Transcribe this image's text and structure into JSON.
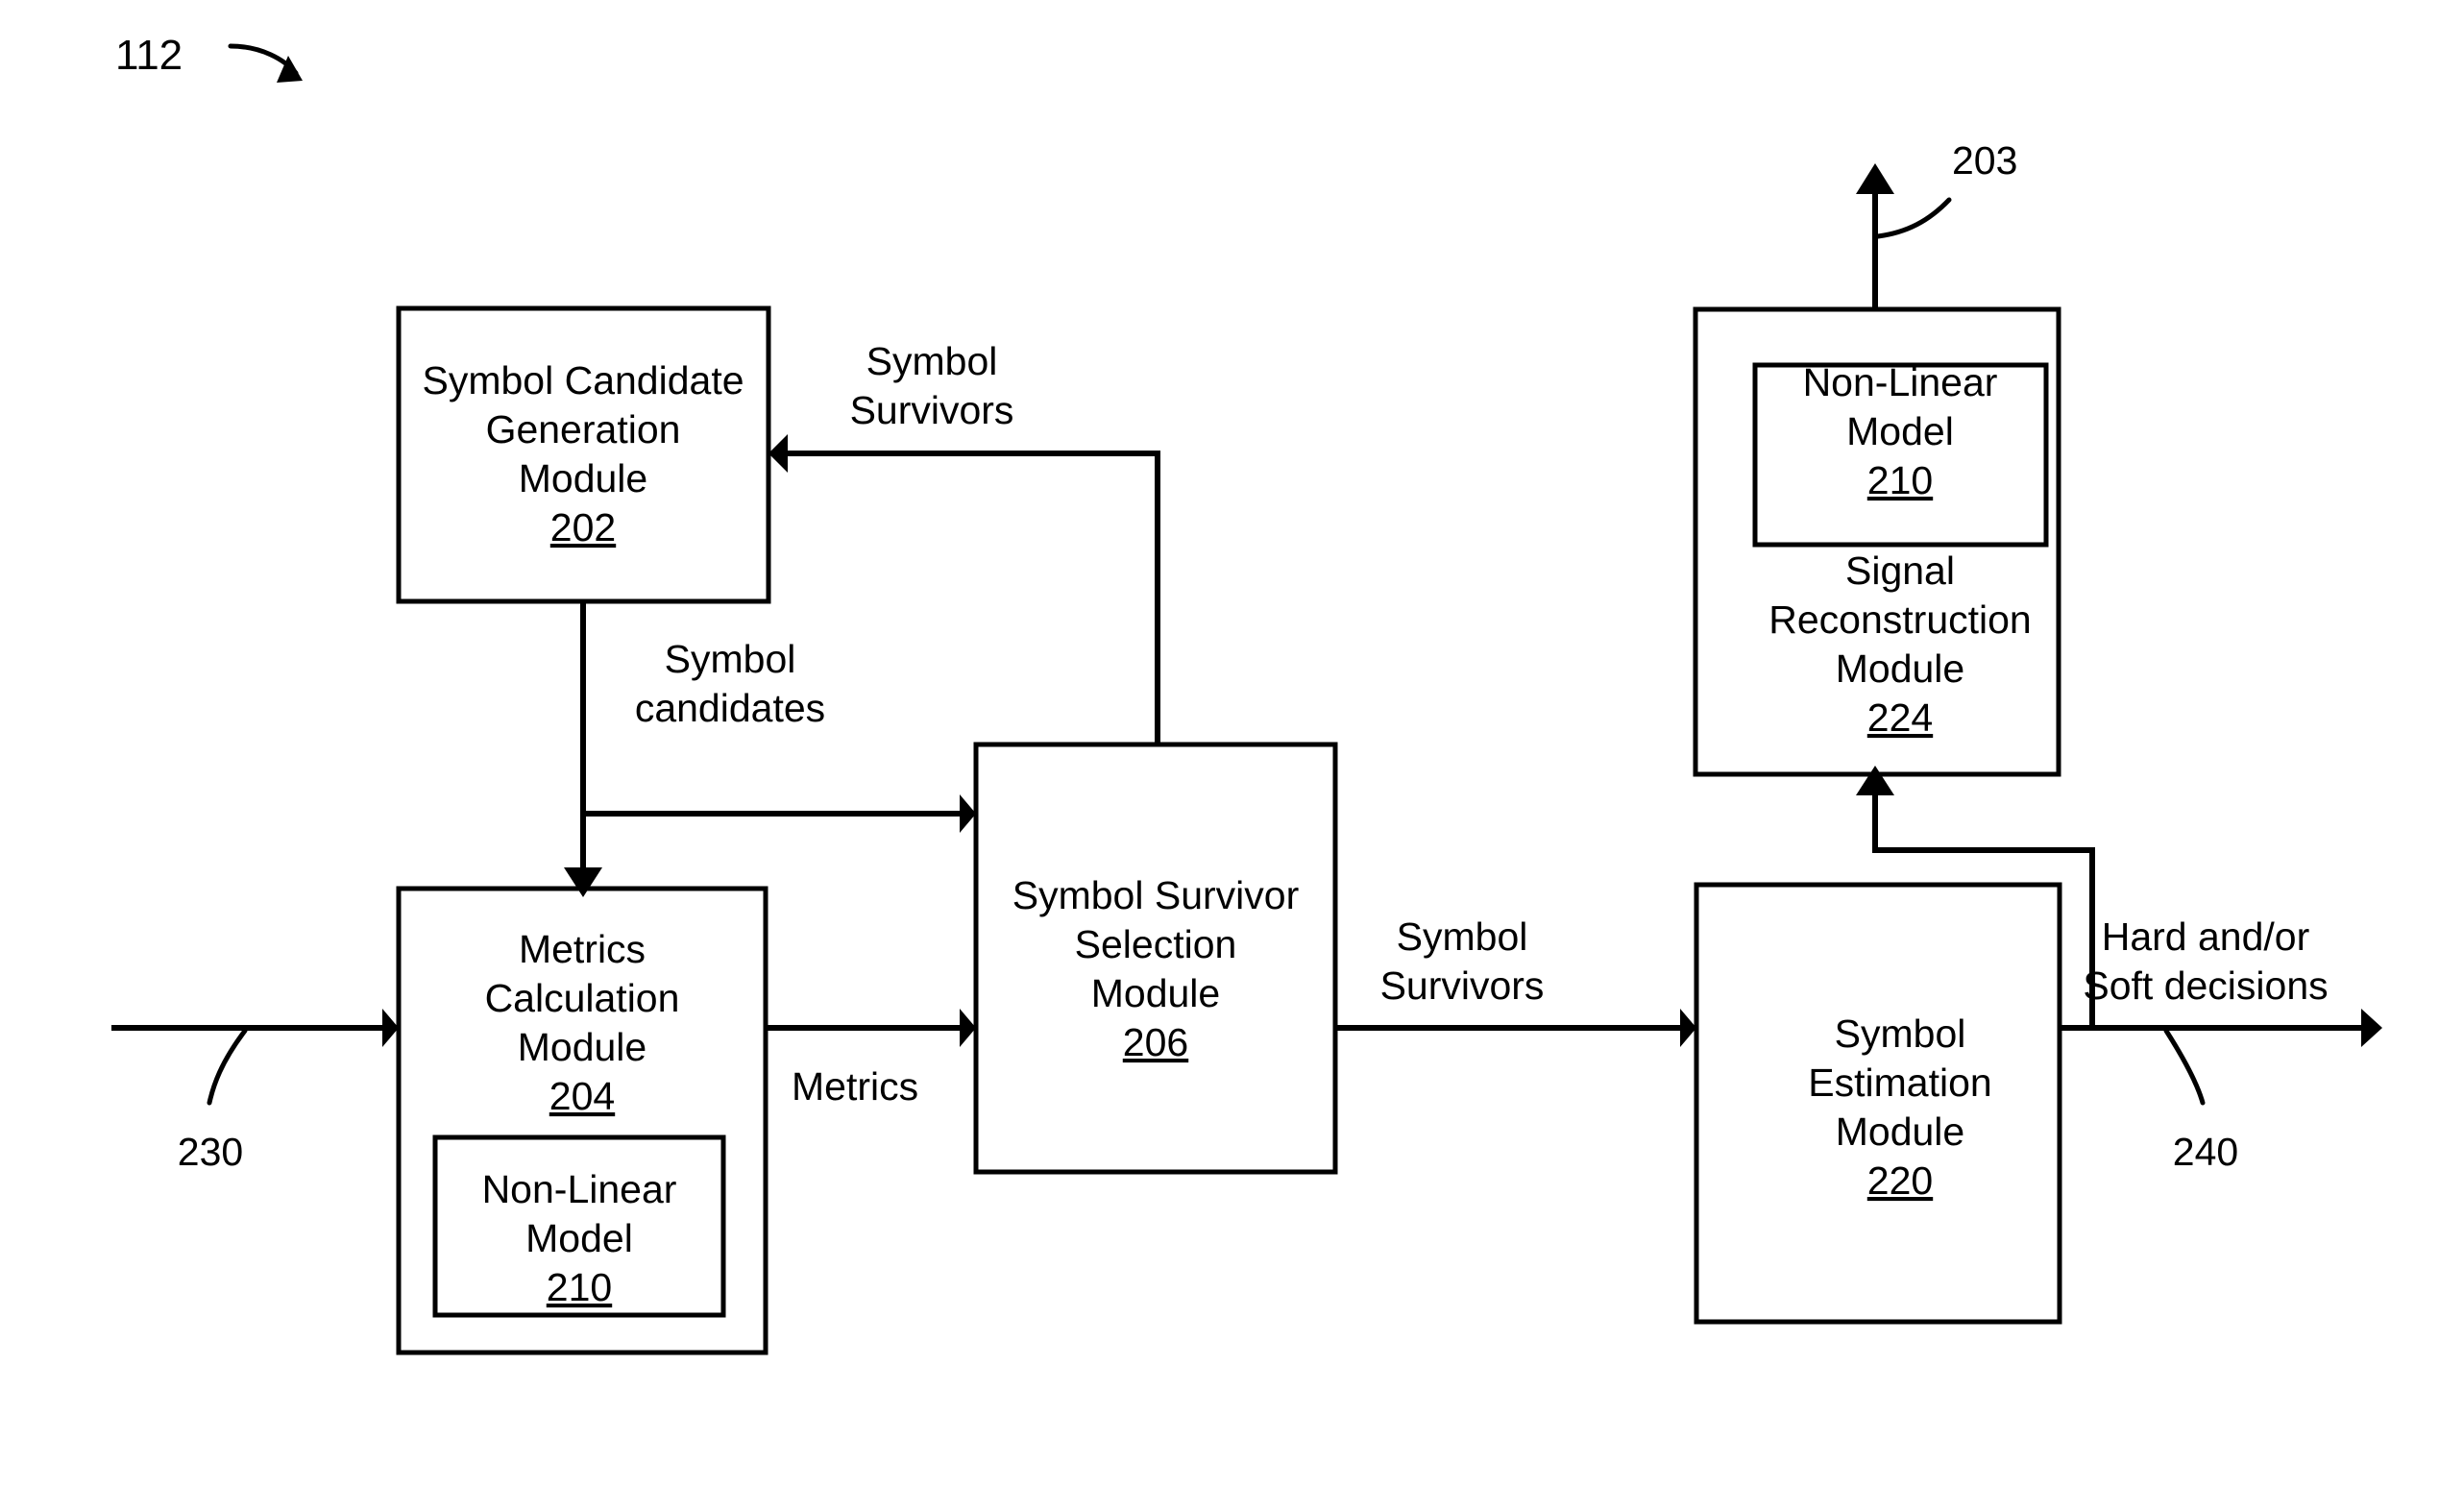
{
  "figure": {
    "number": "112"
  },
  "blocks": [
    {
      "id": "symbol-candidate-generation",
      "lines": [
        "Symbol Candidate",
        "Generation",
        "Module"
      ],
      "ref": "202"
    },
    {
      "id": "metrics-calculation",
      "lines": [
        "Metrics",
        "Calculation",
        "Module"
      ],
      "ref": "204",
      "inner": {
        "id": "non-linear-model-204",
        "lines": [
          "Non-Linear",
          "Model"
        ],
        "ref": "210"
      }
    },
    {
      "id": "symbol-survivor-selection",
      "lines": [
        "Symbol Survivor",
        "Selection",
        "Module"
      ],
      "ref": "206"
    },
    {
      "id": "signal-reconstruction",
      "lines": [
        "Signal",
        "Reconstruction",
        "Module"
      ],
      "ref": "224",
      "inner": {
        "id": "non-linear-model-224",
        "lines": [
          "Non-Linear",
          "Model"
        ],
        "ref": "210"
      }
    },
    {
      "id": "symbol-estimation",
      "lines": [
        "Symbol",
        "Estimation",
        "Module"
      ],
      "ref": "220"
    }
  ],
  "edge_labels": {
    "symbol_survivors_feedback": [
      "Symbol",
      "Survivors"
    ],
    "symbol_candidates": [
      "Symbol",
      "candidates"
    ],
    "metrics": [
      "Metrics"
    ],
    "symbol_survivors_output": [
      "Symbol",
      "Survivors"
    ],
    "decisions": [
      "Hard and/or",
      "Soft decisions"
    ]
  },
  "reference_numerals": {
    "input_signal": "230",
    "output_decisions": "240",
    "reconstructed_signal": "203"
  },
  "colors": {
    "stroke": "#000000",
    "fill": "#ffffff",
    "background": "#ffffff"
  }
}
